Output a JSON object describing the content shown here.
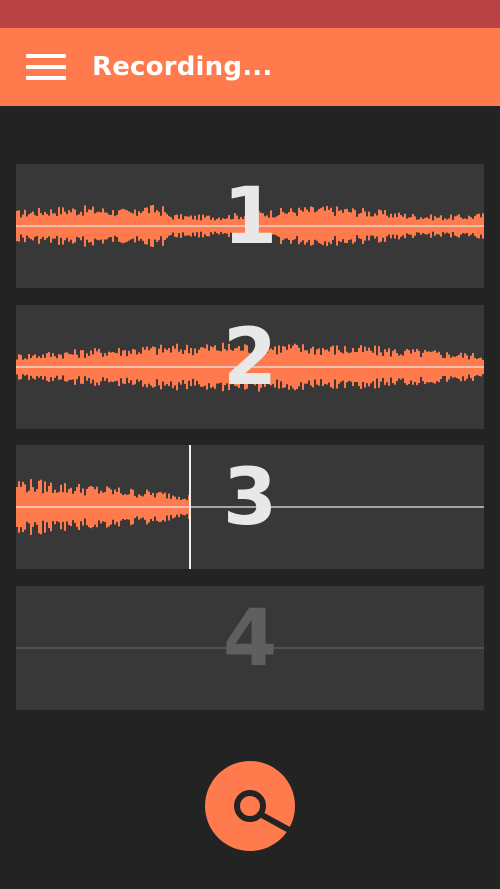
{
  "colors": {
    "status_bar": "#b94343",
    "app_bar": "#ff7a4d",
    "background": "#232323",
    "track_bg": "#383838",
    "waveform": "#ff7a4d",
    "record_button": "#ff7a4d"
  },
  "header": {
    "menu_icon": "hamburger-menu-icon",
    "title": "Recording..."
  },
  "tracks": [
    {
      "number": "1",
      "state": "recorded",
      "progress": 1.0
    },
    {
      "number": "2",
      "state": "recorded",
      "progress": 1.0
    },
    {
      "number": "3",
      "state": "recording",
      "progress": 0.37
    },
    {
      "number": "4",
      "state": "empty",
      "progress": 0.0
    }
  ],
  "record_button": {
    "icon": "record-dial-icon"
  }
}
